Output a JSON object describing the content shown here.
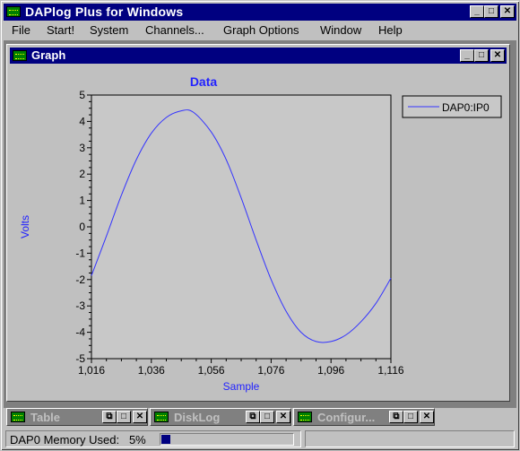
{
  "app": {
    "title": "DAPlog Plus for Windows"
  },
  "menu": [
    "File",
    "Start!",
    "System",
    "Channels...",
    "Graph Options",
    "Window",
    "Help"
  ],
  "graph_window": {
    "title": "Graph"
  },
  "chart_data": {
    "type": "line",
    "title": "Data",
    "xlabel": "Sample",
    "ylabel": "Volts",
    "xlim": [
      1016,
      1116
    ],
    "ylim": [
      -5,
      5
    ],
    "xticks": [
      "1,016",
      "1,036",
      "1,056",
      "1,076",
      "1,096",
      "1,116"
    ],
    "yticks": [
      "5",
      "4",
      "3",
      "2",
      "1",
      "0",
      "-1",
      "-2",
      "-3",
      "-4",
      "-5"
    ],
    "legend_position": "top-right",
    "series": [
      {
        "name": "DAP0:IP0",
        "color": "#3333ff",
        "x": [
          1016,
          1021,
          1026,
          1031,
          1036,
          1041,
          1046,
          1050,
          1056,
          1061,
          1066,
          1071,
          1076,
          1081,
          1086,
          1091,
          1096,
          1101,
          1106,
          1111,
          1116
        ],
        "y": [
          -1.85,
          -0.35,
          1.2,
          2.55,
          3.55,
          4.15,
          4.4,
          4.35,
          3.6,
          2.55,
          1.1,
          -0.5,
          -2.0,
          -3.2,
          -4.0,
          -4.35,
          -4.35,
          -4.1,
          -3.6,
          -2.9,
          -1.95
        ]
      }
    ]
  },
  "minimized_windows": [
    {
      "title": "Table"
    },
    {
      "title": "DiskLog"
    },
    {
      "title": "Configur..."
    }
  ],
  "status": {
    "label": "DAP0 Memory Used:",
    "value": "5%",
    "memory_fraction": 0.05
  }
}
